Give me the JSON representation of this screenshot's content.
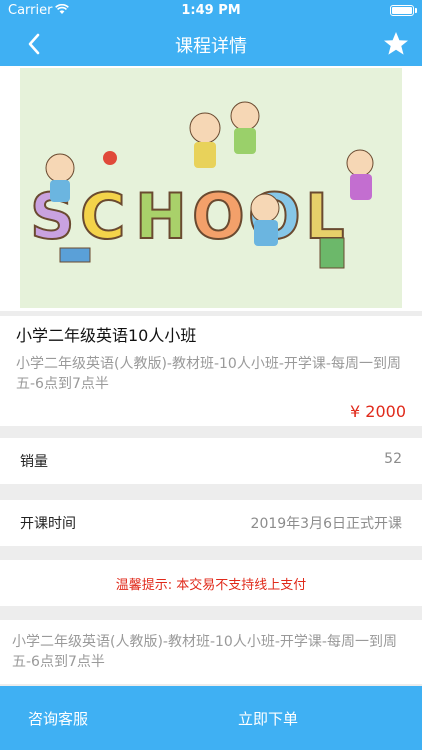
{
  "status_bar": {
    "carrier": "Carrier",
    "time": "1:49 PM"
  },
  "nav": {
    "title": "课程详情",
    "back_icon": "chevron-left-icon",
    "favorite_icon": "star-icon"
  },
  "course": {
    "name": "小学二年级英语10人小班",
    "description": "小学二年级英语(人教版)-教材班-10人小班-开学课-每周一到周五-6点到7点半",
    "price": "¥ 2000"
  },
  "sales": {
    "label": "销量",
    "value": "52"
  },
  "start_time": {
    "label": "开课时间",
    "value": "2019年3月6日正式开课"
  },
  "tip": {
    "text": "温馨提示: 本交易不支持线上支付"
  },
  "detail": {
    "text": "小学二年级英语(人教版)-教材班-10人小班-开学课-每周一到周五-6点到7点半"
  },
  "bottom_bar": {
    "contact_label": "咨询客服",
    "order_label": "立即下单"
  },
  "colors": {
    "accent": "#3fb0f3",
    "price": "#e02a1b",
    "background": "#ededed"
  }
}
